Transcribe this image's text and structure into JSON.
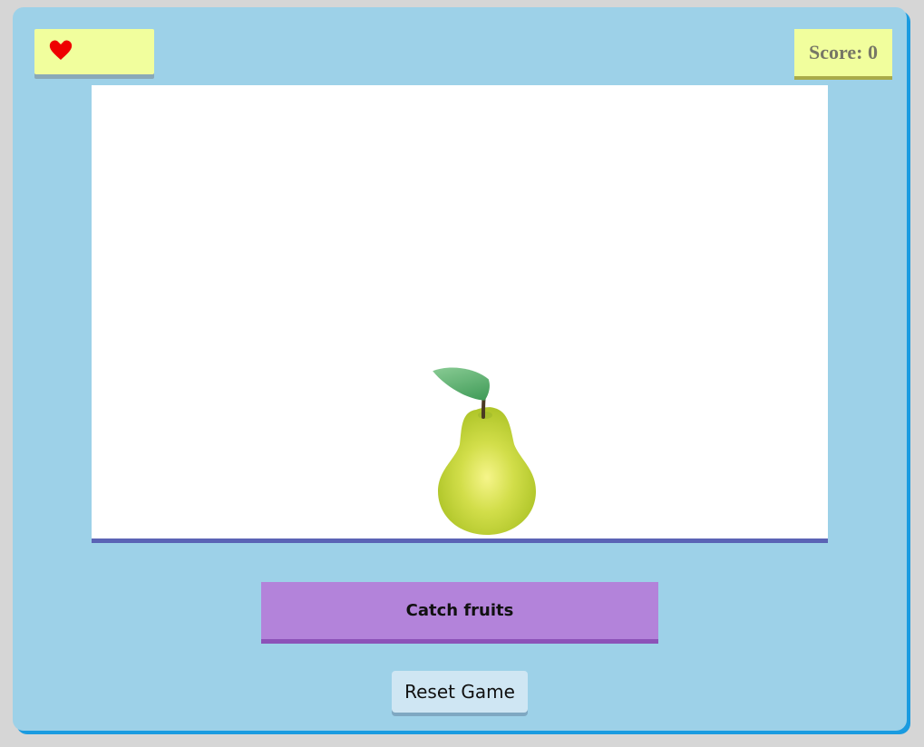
{
  "hud": {
    "lives_icon": "heart-icon",
    "lives_count": 1,
    "score_label": "Score:",
    "score_value": "0"
  },
  "game": {
    "falling_fruit": "pear-icon"
  },
  "controls": {
    "title_label": "Catch fruits",
    "reset_label": "Reset Game"
  },
  "colors": {
    "frame": "#9dd1e8",
    "hud_box": "#f1fe9d",
    "title_button": "#b383da",
    "heart": "#ee0000",
    "floor_line": "#5b63b5"
  }
}
